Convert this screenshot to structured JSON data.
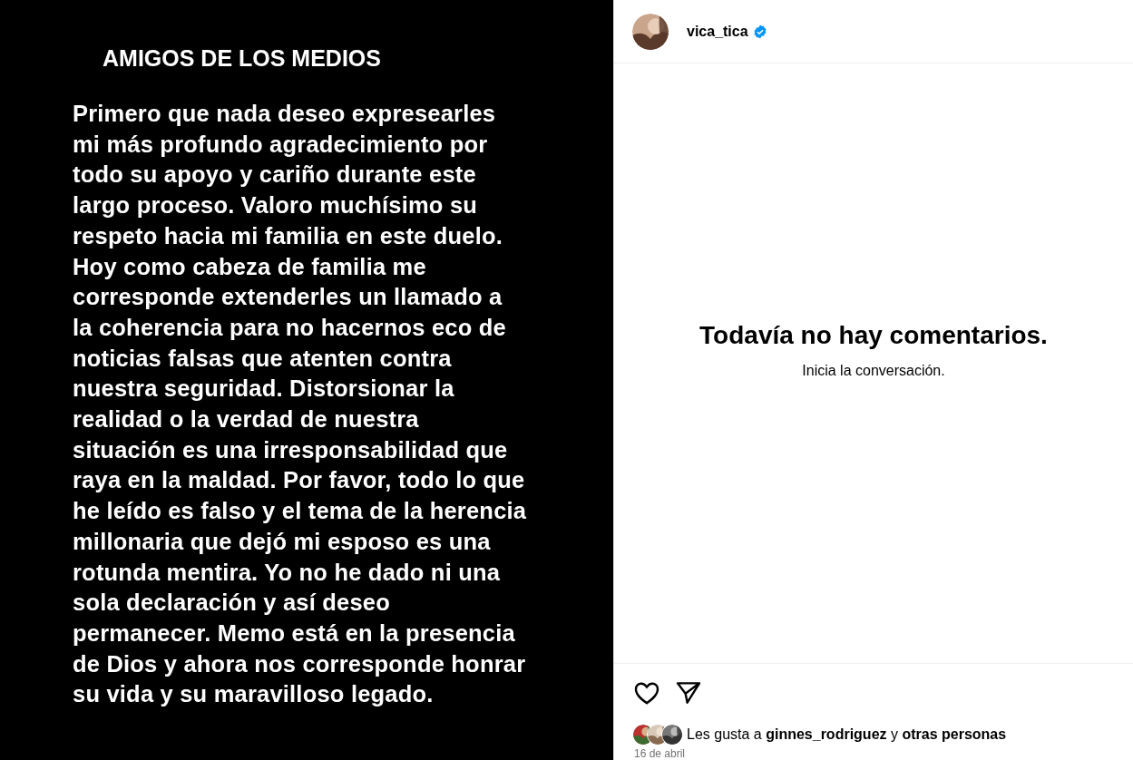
{
  "post_image": {
    "heading": "AMIGOS DE LOS MEDIOS",
    "lines": [
      "Primero que nada deseo expresearles",
      "mi más profundo agradecimiento por",
      "todo su apoyo y cariño durante este",
      "largo proceso. Valoro muchísimo su",
      "respeto hacia mi familia en este duelo.",
      "Hoy como cabeza de familia me",
      "corresponde extenderles un llamado a",
      "la coherencia para no hacernos eco de",
      "noticias falsas que atenten contra",
      "nuestra seguridad. Distorsionar la",
      "realidad o la verdad de nuestra",
      "situación es una irresponsabilidad que",
      "raya en la maldad. Por favor, todo lo que",
      "he leído es falso y el tema de la herencia",
      "millonaria que dejó mi esposo es una",
      "rotunda mentira. Yo no he dado ni una",
      "sola declaración y así deseo",
      "permanecer. Memo está en la presencia",
      "de Dios y ahora nos corresponde honrar",
      "su vida y su maravilloso legado."
    ]
  },
  "header": {
    "username": "vica_tica",
    "verified": true
  },
  "comments": {
    "empty_title": "Todavía no hay comentarios.",
    "empty_hint": "Inicia la conversación."
  },
  "actions": {
    "liked": false
  },
  "likes": {
    "text": "Les gusta a **ginnes_rodriguez** y **otras personas**"
  },
  "date": "16 de abril"
}
